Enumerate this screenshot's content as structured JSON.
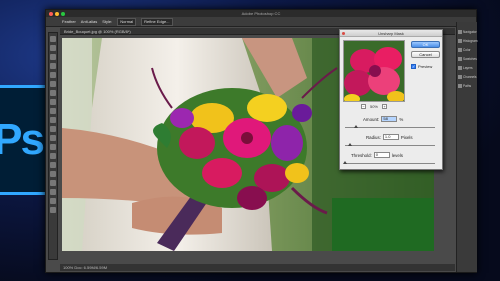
{
  "window": {
    "title": "Adobe Photoshop CC",
    "traffic_colors": [
      "#ff5f57",
      "#febc2e",
      "#28c840"
    ]
  },
  "background_logo": {
    "text": "Ps"
  },
  "options_bar": {
    "items": [
      "Feather",
      "Anti-alias",
      "Style:",
      "Normal",
      "Refine Edge..."
    ]
  },
  "document": {
    "tab": "Bride_Bouquet.jpg @ 100% (RGB/8*)",
    "status": "100%    Doc: 6.59M/6.59M"
  },
  "right_panel": {
    "items": [
      "Navigator",
      "Histogram",
      "Color",
      "Swatches",
      "Layers",
      "Channels",
      "Paths"
    ]
  },
  "dialog": {
    "title": "Unsharp Mask",
    "ok_label": "OK",
    "cancel_label": "Cancel",
    "preview_label": "Preview",
    "preview_checked": true,
    "zoom_label": "50%",
    "zoom_out": "−",
    "zoom_in": "+",
    "amount_label": "Amount:",
    "amount_value": "58",
    "amount_unit": "%",
    "amount_level": 0.12,
    "radius_label": "Radius:",
    "radius_value": "1.0",
    "radius_unit": "Pixels",
    "radius_level": 0.05,
    "threshold_label": "Threshold:",
    "threshold_value": "0",
    "threshold_unit": "levels",
    "threshold_level": 0.0
  }
}
